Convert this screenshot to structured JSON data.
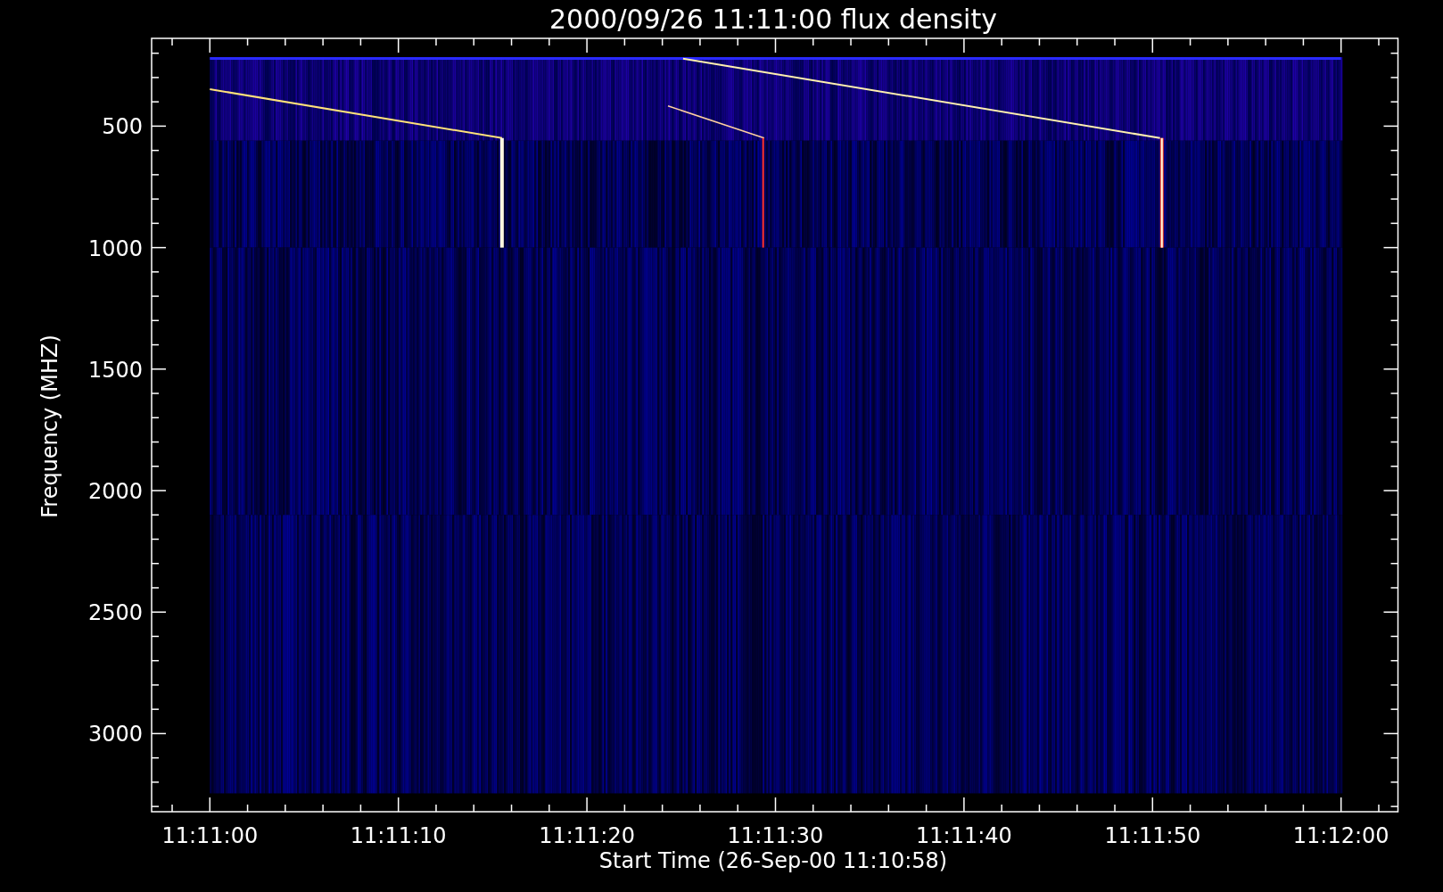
{
  "title": "2000/09/26 11:11:00 flux density",
  "y_axis": {
    "label": "Frequency (MHZ)",
    "tick_labels": [
      "500",
      "1000",
      "1500",
      "2000",
      "2500",
      "3000"
    ]
  },
  "x_axis": {
    "label": "Start Time (26-Sep-00 11:10:58)",
    "tick_labels": [
      "11:11:00",
      "11:11:10",
      "11:11:20",
      "11:11:30",
      "11:11:40",
      "11:11:50",
      "11:12:00"
    ]
  }
}
